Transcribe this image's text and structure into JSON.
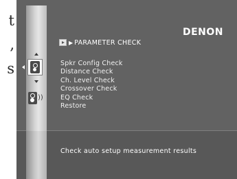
{
  "background_page": {
    "text_fragments": [
      "t",
      ",",
      "s"
    ]
  },
  "header": {
    "brand": "DENON",
    "title_arrow": "▶",
    "title": "PARAMETER CHECK"
  },
  "menu": {
    "items": [
      {
        "label": "Spkr Config Check"
      },
      {
        "label": "Distance Check"
      },
      {
        "label": "Ch. Level Check"
      },
      {
        "label": "Crossover Check"
      },
      {
        "label": "EQ Check"
      },
      {
        "label": "Restore"
      }
    ]
  },
  "sidebar": {
    "icons": [
      "nav-left-icon",
      "nav-up-icon",
      "audyssey-setup-icon",
      "nav-down-icon",
      "speaker-icon"
    ],
    "speaker_waves": "))"
  },
  "status": {
    "message": "Check auto setup measurement results"
  },
  "colors": {
    "screen_bg": "#626262",
    "bottom_bg": "#585858",
    "text": "#ffffff"
  }
}
